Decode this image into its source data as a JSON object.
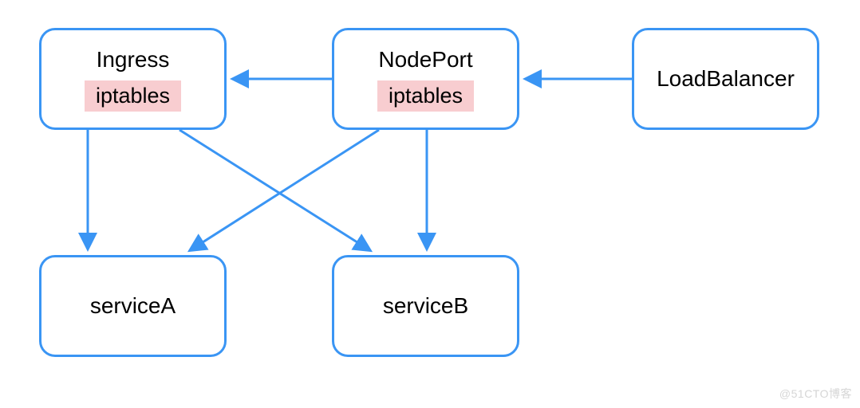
{
  "nodes": {
    "ingress": {
      "title": "Ingress",
      "badge": "iptables"
    },
    "nodeport": {
      "title": "NodePort",
      "badge": "iptables"
    },
    "loadbalancer": {
      "title": "LoadBalancer"
    },
    "serviceA": {
      "title": "serviceA"
    },
    "serviceB": {
      "title": "serviceB"
    }
  },
  "colors": {
    "border": "#3a95f4",
    "arrow": "#3a95f4",
    "highlight": "#f8cdd0"
  },
  "edges": [
    {
      "from": "loadbalancer",
      "to": "nodeport"
    },
    {
      "from": "nodeport",
      "to": "ingress"
    },
    {
      "from": "ingress",
      "to": "serviceA"
    },
    {
      "from": "ingress",
      "to": "serviceB"
    },
    {
      "from": "nodeport",
      "to": "serviceA"
    },
    {
      "from": "nodeport",
      "to": "serviceB"
    }
  ],
  "watermark": "@51CTO博客"
}
